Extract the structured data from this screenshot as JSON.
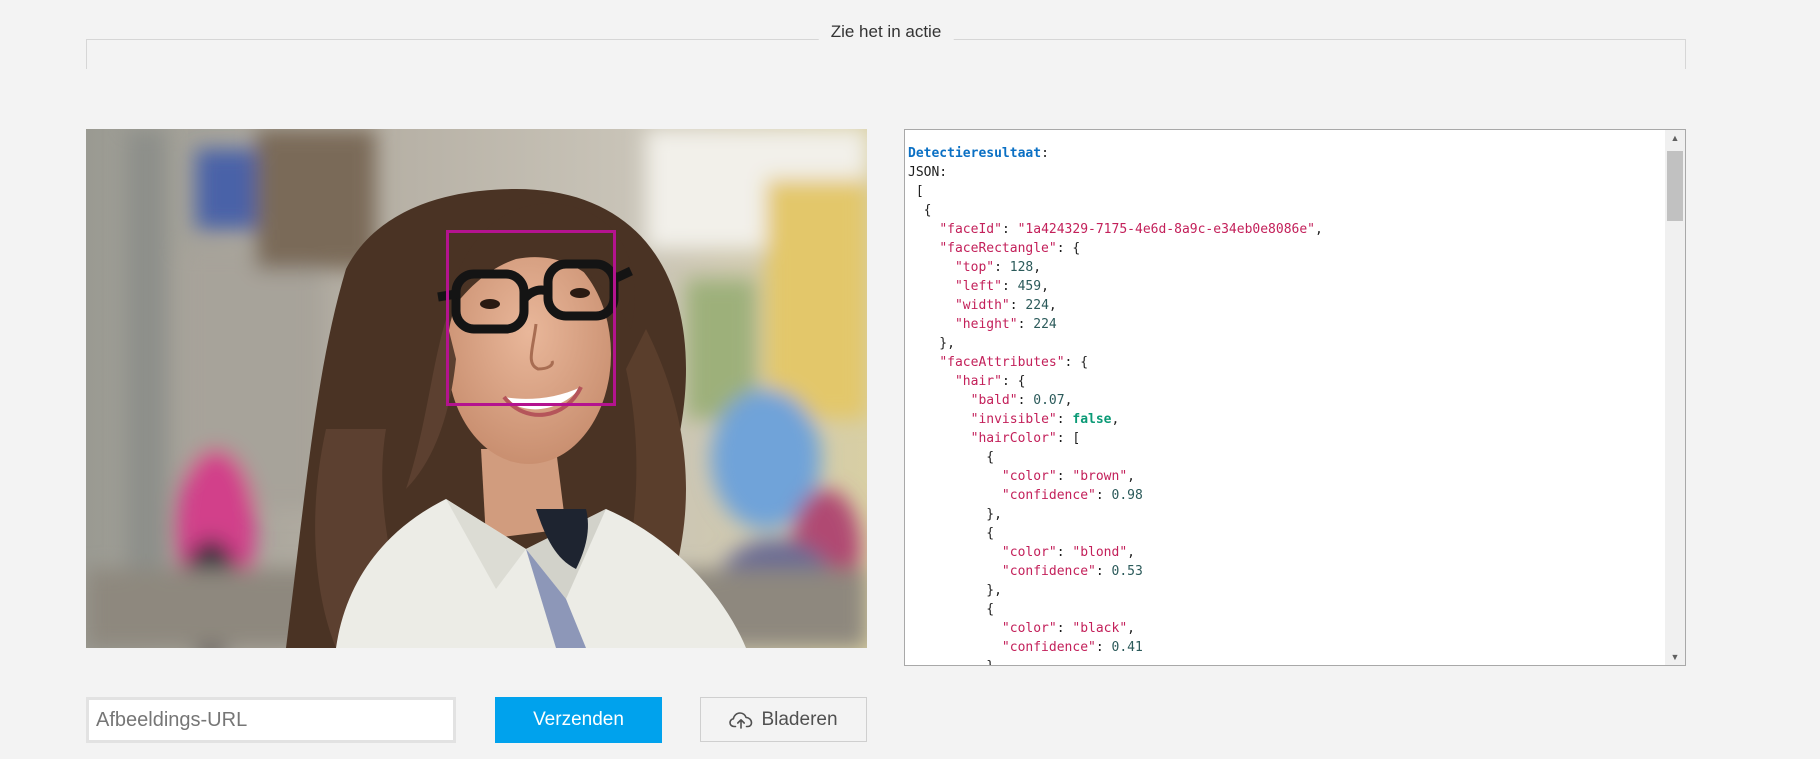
{
  "section": {
    "title": "Zie het in actie"
  },
  "result": {
    "header_label": "Detectieresultaat",
    "json_label": "JSON:",
    "face_id": "\"1a424329-7175-4e6d-8a9c-e34eb0e8086e\"",
    "rect_top": "128",
    "rect_left": "459",
    "rect_width": "224",
    "rect_height": "224",
    "hair_bald": "0.07",
    "hair_invisible": "false",
    "hair_color_1": "\"brown\"",
    "hair_conf_1": "0.98",
    "hair_color_2": "\"blond\"",
    "hair_conf_2": "0.53",
    "hair_color_3": "\"black\"",
    "hair_conf_3": "0.41"
  },
  "controls": {
    "url_placeholder": "Afbeeldings-URL",
    "url_value": "",
    "submit_label": "Verzenden",
    "browse_label": "Bladeren",
    "browse_icon": "cloud-upload-icon"
  },
  "icons": {
    "scroll_up": "triangle-up",
    "scroll_down": "triangle-down"
  },
  "colors": {
    "accent": "#00a2ed",
    "face_box": "#b4138f",
    "json_key": "#c3205a",
    "json_header": "#0b70c4",
    "json_bool": "#0b9a76"
  }
}
